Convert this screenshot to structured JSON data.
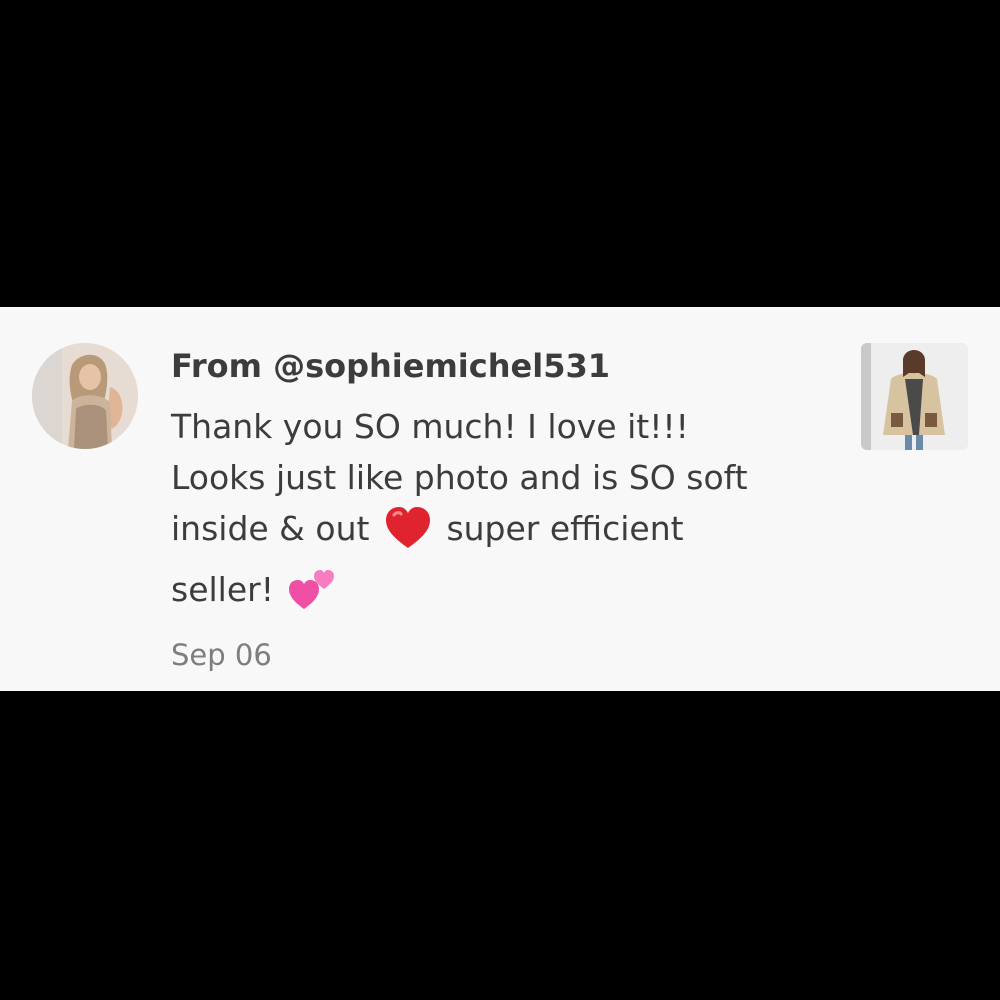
{
  "comment": {
    "username_line": "From @sophiemichel531",
    "message_lines": [
      "Thank you SO much! I love it!!!",
      "Looks just like photo and is SO soft",
      "inside & out",
      "super efficient",
      "seller!"
    ],
    "date": "Sep 06",
    "emojis": [
      "red-heart",
      "two-hearts"
    ]
  },
  "colors": {
    "background": "#000000",
    "card": "#f8f8f8",
    "text": "#3c3c3c",
    "muted": "#7e7e7e",
    "heart_red": "#e0242f",
    "hearts_pink": "#f04fa6"
  }
}
